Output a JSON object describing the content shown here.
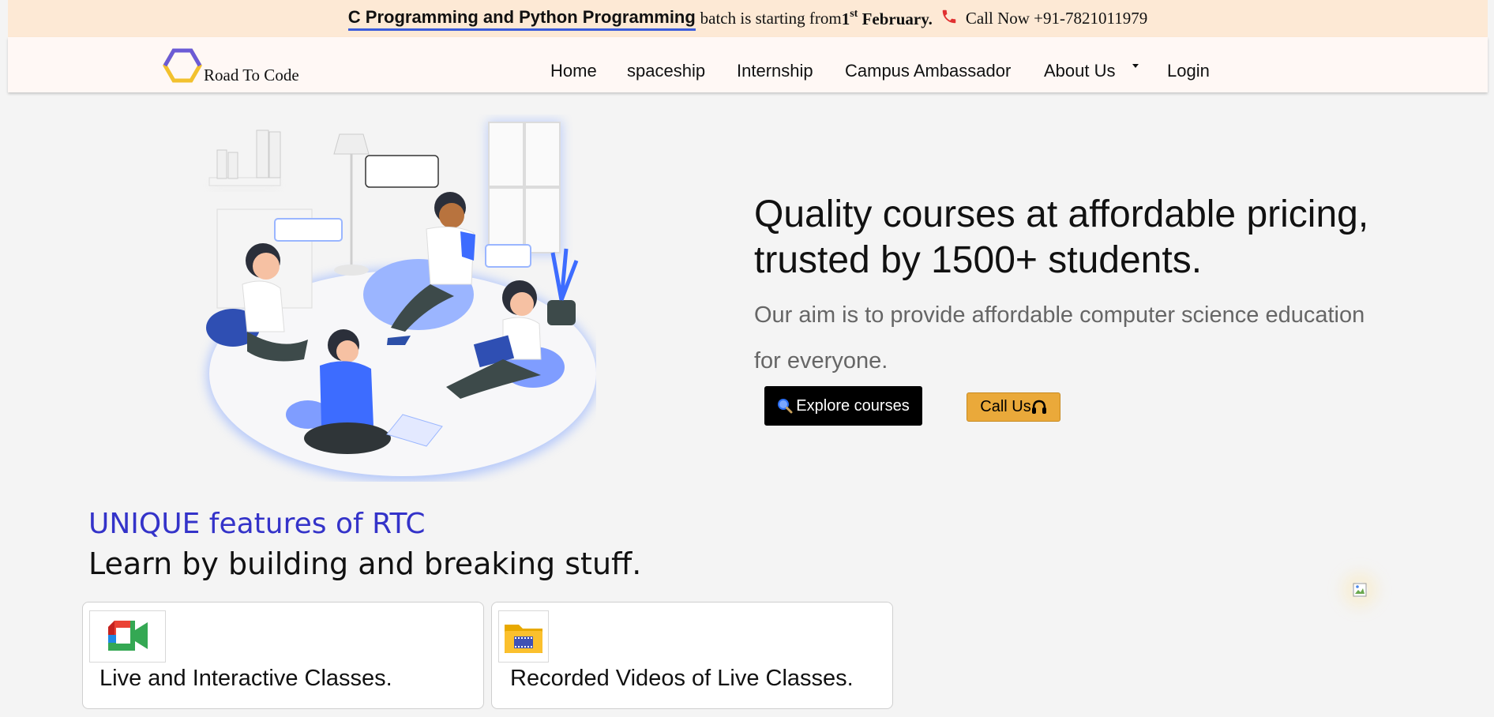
{
  "announcement": {
    "course": "C Programming and Python Programming",
    "text": "batch is starting from",
    "date_day": "1",
    "date_suffix": "st",
    "date_month": "February.",
    "call": "Call Now +91-7821011979"
  },
  "brand": {
    "name": "Road To Code"
  },
  "nav": {
    "home": "Home",
    "spaceship": "spaceship",
    "internship": "Internship",
    "ambassador": "Campus Ambassador",
    "about": "About Us",
    "login": "Login"
  },
  "hero": {
    "title": "Quality courses at affordable pricing, trusted by 1500+ students.",
    "subtitle": "Our aim is to provide affordable computer science education for everyone.",
    "explore_label": "Explore courses",
    "call_label": "Call Us"
  },
  "features": {
    "kicker": "UNIQUE features of RTC",
    "heading": "Learn by building and breaking stuff.",
    "cards": [
      {
        "label": "Live and Interactive Classes.",
        "icon": "video-meet-icon"
      },
      {
        "label": "Recorded Videos of Live Classes.",
        "icon": "video-folder-icon"
      }
    ]
  },
  "colors": {
    "announce_bg": "#fde9d5",
    "accent_blue": "#3433c9",
    "call_button": "#eaa93a",
    "explore_button": "#000000"
  }
}
